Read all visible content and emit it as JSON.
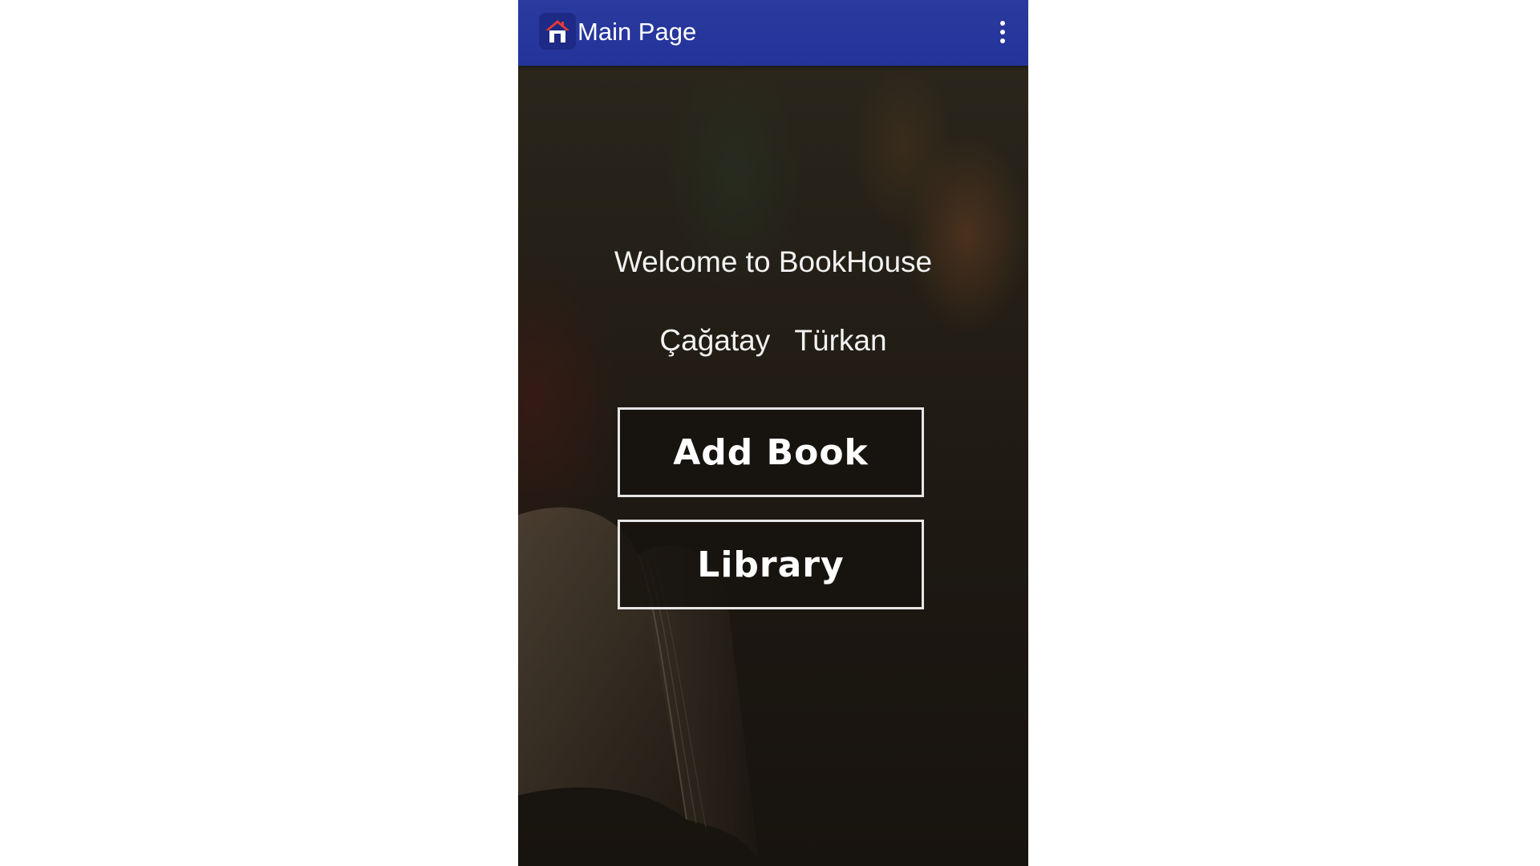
{
  "app_bar": {
    "title": "Main Page",
    "icon": "home-icon",
    "menu_icon": "overflow-menu-icon"
  },
  "main": {
    "welcome_text": "Welcome to BookHouse",
    "user_name": "Çağatay   Türkan",
    "buttons": {
      "add_book": "Add Book",
      "library": "Library"
    }
  },
  "colors": {
    "app_bar": "#2a3a9e",
    "icon_roof": "#e53935",
    "button_border": "#e6e6e6",
    "text": "#f2f2f2"
  }
}
